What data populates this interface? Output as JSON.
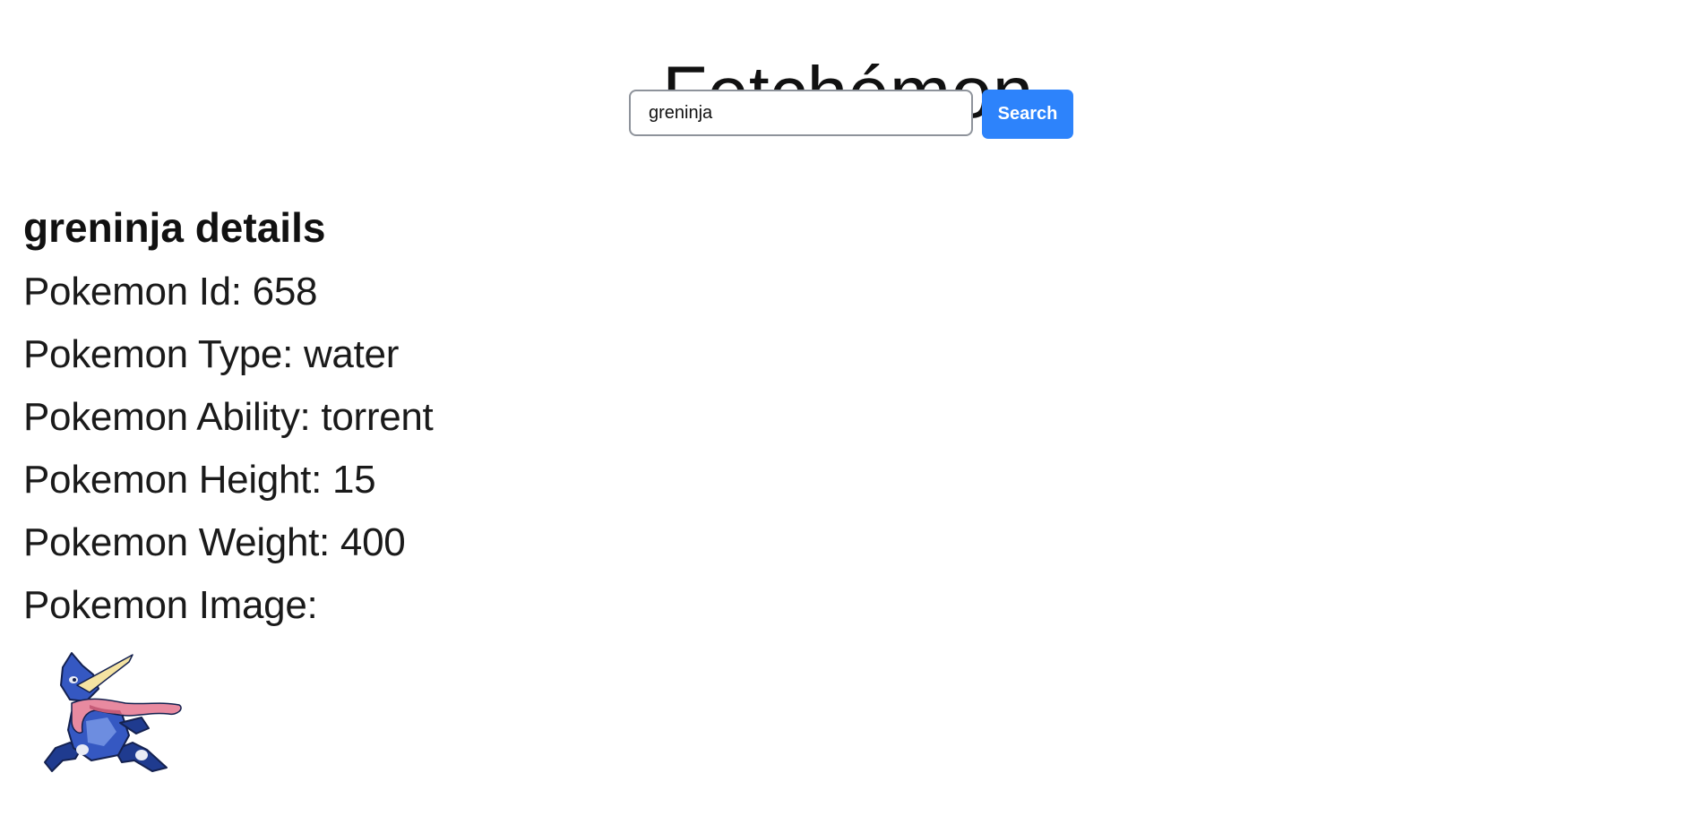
{
  "header": {
    "title": "Fetchémon"
  },
  "search": {
    "value": "greninja",
    "placeholder": "",
    "button_label": "Search"
  },
  "details": {
    "heading": "greninja details",
    "id_line": "Pokemon Id: 658",
    "type_line": "Pokemon Type: water",
    "ability_line": "Pokemon Ability: torrent",
    "height_line": "Pokemon Height: 15",
    "weight_line": "Pokemon Weight: 400",
    "image_line": "Pokemon Image:"
  },
  "sprite": {
    "name": "greninja-sprite",
    "colors": {
      "body_dark": "#1f3b8f",
      "body_mid": "#3558c2",
      "body_light": "#6d8de0",
      "tongue": "#e88aa0",
      "tongue_shadow": "#c65c78",
      "cream": "#f4e3a2",
      "outline": "#14214f",
      "white": "#e9ecf5"
    }
  },
  "theme": {
    "accent": "#2d83fb",
    "input_border": "#8e939b"
  }
}
